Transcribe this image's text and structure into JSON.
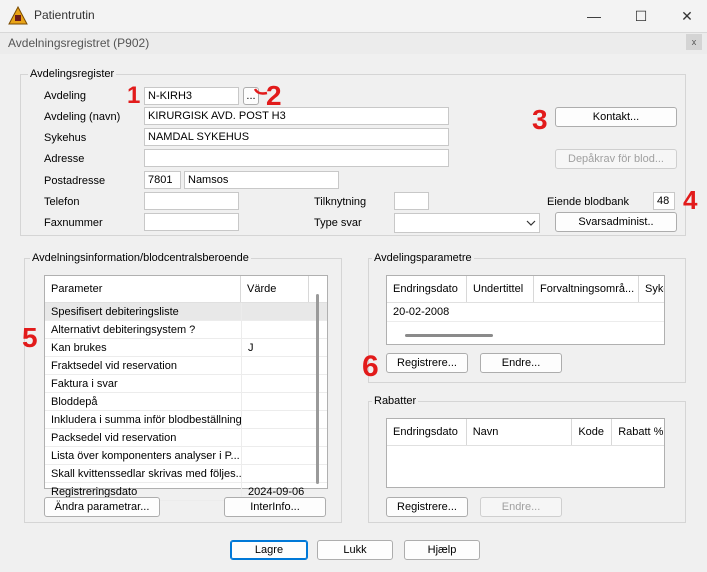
{
  "window": {
    "title": "Patientrutin",
    "subtitle": "Avdelningsregistret (P902)"
  },
  "avdelingsregister": {
    "group_label": "Avdelingsregister",
    "avdeling_label": "Avdeling",
    "avdeling_value": "N-KIRH3",
    "lookup_button": "...",
    "avdeling_navn_label": "Avdeling (navn)",
    "avdeling_navn_value": "KIRURGISK AVD. POST H3",
    "sykehus_label": "Sykehus",
    "sykehus_value": "NAMDAL SYKEHUS",
    "adresse_label": "Adresse",
    "adresse_value": "",
    "postadresse_label": "Postadresse",
    "postnr_value": "7801",
    "poststed_value": "Namsos",
    "telefon_label": "Telefon",
    "telefon_value": "",
    "faxnummer_label": "Faxnummer",
    "faxnummer_value": "",
    "tilknytning_label": "Tilknytning",
    "tilknytning_value": "",
    "type_svar_label": "Type svar",
    "type_svar_value": "",
    "eiende_blodbank_label": "Eiende blodbank",
    "eiende_blodbank_value": "48",
    "kontakt_button": "Kontakt...",
    "depakrav_button": "Depåkrav för blod...",
    "svarsadmin_button": "Svarsadminist.."
  },
  "avdelningsinformation": {
    "group_label": "Avdelningsinformation/blodcentralsberoende",
    "columns": [
      "Parameter",
      "Värde"
    ],
    "rows": [
      {
        "parameter": "Spesifisert debiteringsliste",
        "value": ""
      },
      {
        "parameter": "Alternativt debiteringsystem ?",
        "value": ""
      },
      {
        "parameter": "Kan brukes",
        "value": "J"
      },
      {
        "parameter": "Fraktsedel vid reservation",
        "value": ""
      },
      {
        "parameter": "Faktura i svar",
        "value": ""
      },
      {
        "parameter": "Bloddepå",
        "value": ""
      },
      {
        "parameter": "Inkludera i summa inför blodbeställning",
        "value": ""
      },
      {
        "parameter": "Packsedel vid reservation",
        "value": ""
      },
      {
        "parameter": "Lista över komponenters analyser i P...",
        "value": ""
      },
      {
        "parameter": "Skall kvittenssedlar skrivas med följes...",
        "value": ""
      },
      {
        "parameter": "Registreringsdato",
        "value": "2024-09-06"
      }
    ],
    "andra_button": "Ändra parametrar...",
    "interinfo_button": "InterInfo..."
  },
  "avdelingsparametre": {
    "group_label": "Avdelingsparametre",
    "columns": [
      "Endringsdato",
      "Undertittel",
      "Forvaltningsområ...",
      "Syke"
    ],
    "rows": [
      {
        "endringsdato": "20-02-2008"
      }
    ],
    "registrere_button": "Registrere...",
    "endre_button": "Endre..."
  },
  "rabatter": {
    "group_label": "Rabatter",
    "columns": [
      "Endringsdato",
      "Navn",
      "Kode",
      "Rabatt %"
    ],
    "registrere_button": "Registrere...",
    "endre_button": "Endre..."
  },
  "footer": {
    "lagre": "Lagre",
    "lukk": "Lukk",
    "hjaelp": "Hjælp"
  },
  "annotations": [
    "1",
    "2",
    "3",
    "4",
    "5",
    "6"
  ],
  "colors": {
    "annotation": "#e21b1b",
    "default_button_border": "#0078d7"
  },
  "window_controls": {
    "minimize": "—",
    "maximize": "☐",
    "close": "✕"
  }
}
